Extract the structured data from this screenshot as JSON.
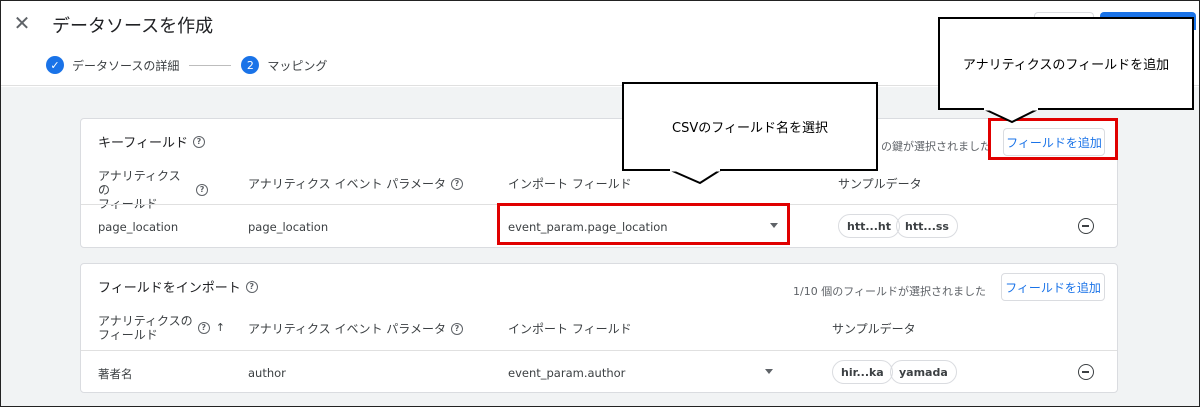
{
  "header": {
    "title": "データソースを作成",
    "steps": [
      {
        "label": "データソースの詳細",
        "done": true
      },
      {
        "number": "2",
        "label": "マッピング"
      }
    ]
  },
  "key_fields": {
    "title": "キーフィールド",
    "selected_text": "の鍵が選択されました",
    "add_button": "フィールドを追加",
    "columns": [
      "アナリティクスの\nフィールド",
      "アナリティクス イベント パラメータ",
      "インポート フィールド",
      "サンプルデータ"
    ],
    "rows": [
      {
        "field": "page_location",
        "param": "page_location",
        "import": "event_param.page_location",
        "samples": [
          "htt...ht",
          "htt...ss"
        ]
      }
    ]
  },
  "import_fields": {
    "title": "フィールドをインポート",
    "selected_text": "1/10 個のフィールドが選択されました",
    "add_button": "フィールドを追加",
    "columns": [
      "アナリティクスの\nフィールド",
      "アナリティクス イベント パラメータ",
      "インポート フィールド",
      "サンプルデータ"
    ],
    "rows": [
      {
        "field": "著者名",
        "param": "author",
        "import": "event_param.author",
        "samples": [
          "hir...ka",
          "yamada"
        ]
      }
    ]
  },
  "callouts": {
    "csv": "CSVのフィールド名を選択",
    "analytics": "アナリティクスのフィールドを追加"
  },
  "colors": {
    "accent": "#1a73e8",
    "highlight": "#e00000"
  }
}
